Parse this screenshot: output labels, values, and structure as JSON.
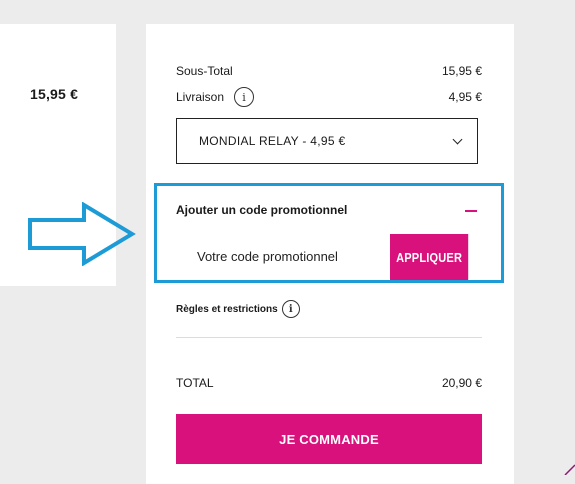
{
  "left_panel": {
    "price": "15,95 €"
  },
  "summary": {
    "subtotal": {
      "label": "Sous-Total",
      "value": "15,95 €"
    },
    "shipping": {
      "label": "Livraison",
      "value": "4,95 €",
      "info_icon": "info-icon"
    },
    "shipping_option": {
      "selected": "MONDIAL RELAY - 4,95 €",
      "icon": "chevron-down-icon"
    },
    "promo": {
      "title": "Ajouter un code promotionnel",
      "collapse_icon": "minus-icon",
      "placeholder": "Votre code promotionnel",
      "apply_label": "APPLIQUER"
    },
    "rules": {
      "label": "Règles et restrictions",
      "info_icon": "info-icon"
    },
    "total": {
      "label": "TOTAL",
      "value": "20,90 €"
    },
    "order_button_label": "JE COMMANDE"
  },
  "annotation": {
    "arrow_icon": "arrow-right-icon",
    "highlight_color": "#1c9bd6"
  },
  "colors": {
    "accent": "#d8117d",
    "background": "#ececec",
    "card": "#ffffff"
  }
}
